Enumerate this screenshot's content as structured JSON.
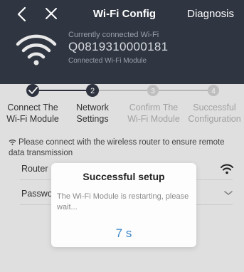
{
  "nav": {
    "title": "Wi-Fi Config",
    "diagnosis_label": "Diagnosis"
  },
  "connection": {
    "label": "Currently connected Wi-Fi",
    "ssid": "Q0819310000181",
    "module_label": "Connected Wi-Fi Module"
  },
  "steps": [
    {
      "line1": "Connect The",
      "line2": "Wi-Fi Module",
      "number": "",
      "status": "done"
    },
    {
      "line1": "Network",
      "line2": "Settings",
      "number": "2",
      "status": "current"
    },
    {
      "line1": "Confirm The",
      "line2": "Wi-Fi Module",
      "number": "3",
      "status": "pending"
    },
    {
      "line1": "Successful",
      "line2": "Configuration",
      "number": "4",
      "status": "pending"
    }
  ],
  "note": "Please connect with the wireless router to ensure remote data transmission",
  "form": {
    "router_label": "Router",
    "password_label": "Passwor"
  },
  "dialog": {
    "title": "Successful setup",
    "message": "The Wi-Fi Module is restarting, please wait...",
    "countdown": "7 s"
  },
  "colors": {
    "header_bg": "#2f3541",
    "accent": "#3a86c8",
    "step_active": "#2f3541",
    "step_inactive": "#bdbdbd"
  }
}
